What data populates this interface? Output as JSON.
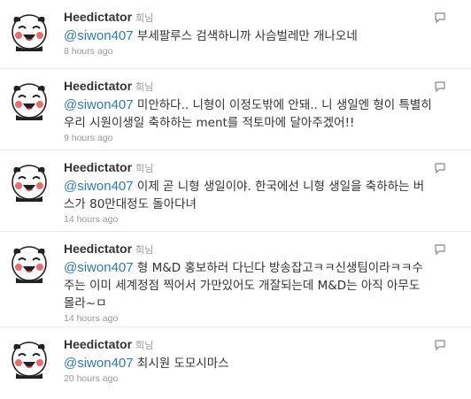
{
  "timeline": {
    "tweets": [
      {
        "screen_name": "Heedictator",
        "full_name": "희님",
        "mention": "@siwon407",
        "text": " 부세팔루스 검색하니까 사슴벌레만 개나오네",
        "time": "8 hours ago",
        "avatar_icon": "panda-face-icon",
        "action_icon": "reply-icon"
      },
      {
        "screen_name": "Heedictator",
        "full_name": "희님",
        "mention": "@siwon407",
        "text": " 미안하다.. 니형이 이정도밖에 안돼.. 니 생일엔 형이 특별히 우리 시원이생일 축하하는 ment를 적토마에 달아주겠어!!",
        "time": "9 hours ago",
        "avatar_icon": "panda-face-icon",
        "action_icon": "reply-icon"
      },
      {
        "screen_name": "Heedictator",
        "full_name": "희님",
        "mention": "@siwon407",
        "text": " 이제 곧 니형 생일이야. 한국에선 니형 생일을 축하하는 버스가 80만대정도 돌아다녀",
        "time": "14 hours ago",
        "avatar_icon": "panda-face-icon",
        "action_icon": "reply-icon"
      },
      {
        "screen_name": "Heedictator",
        "full_name": "희님",
        "mention": "@siwon407",
        "text": " 형 M&D 홍보하러 다닌다 방송잡고ㅋㅋ신생팀이라ㅋㅋ수주는 이미 세계정점 찍어서 가만있어도 개잘되는데 M&D는 아직 아무도 몰라~ㅁ",
        "time": "14 hours ago",
        "avatar_icon": "panda-face-icon",
        "action_icon": "reply-icon"
      },
      {
        "screen_name": "Heedictator",
        "full_name": "희님",
        "mention": "@siwon407",
        "text": " 최시원 도모시마스",
        "time": "20 hours ago",
        "avatar_icon": "panda-face-icon",
        "action_icon": "reply-icon"
      }
    ]
  }
}
